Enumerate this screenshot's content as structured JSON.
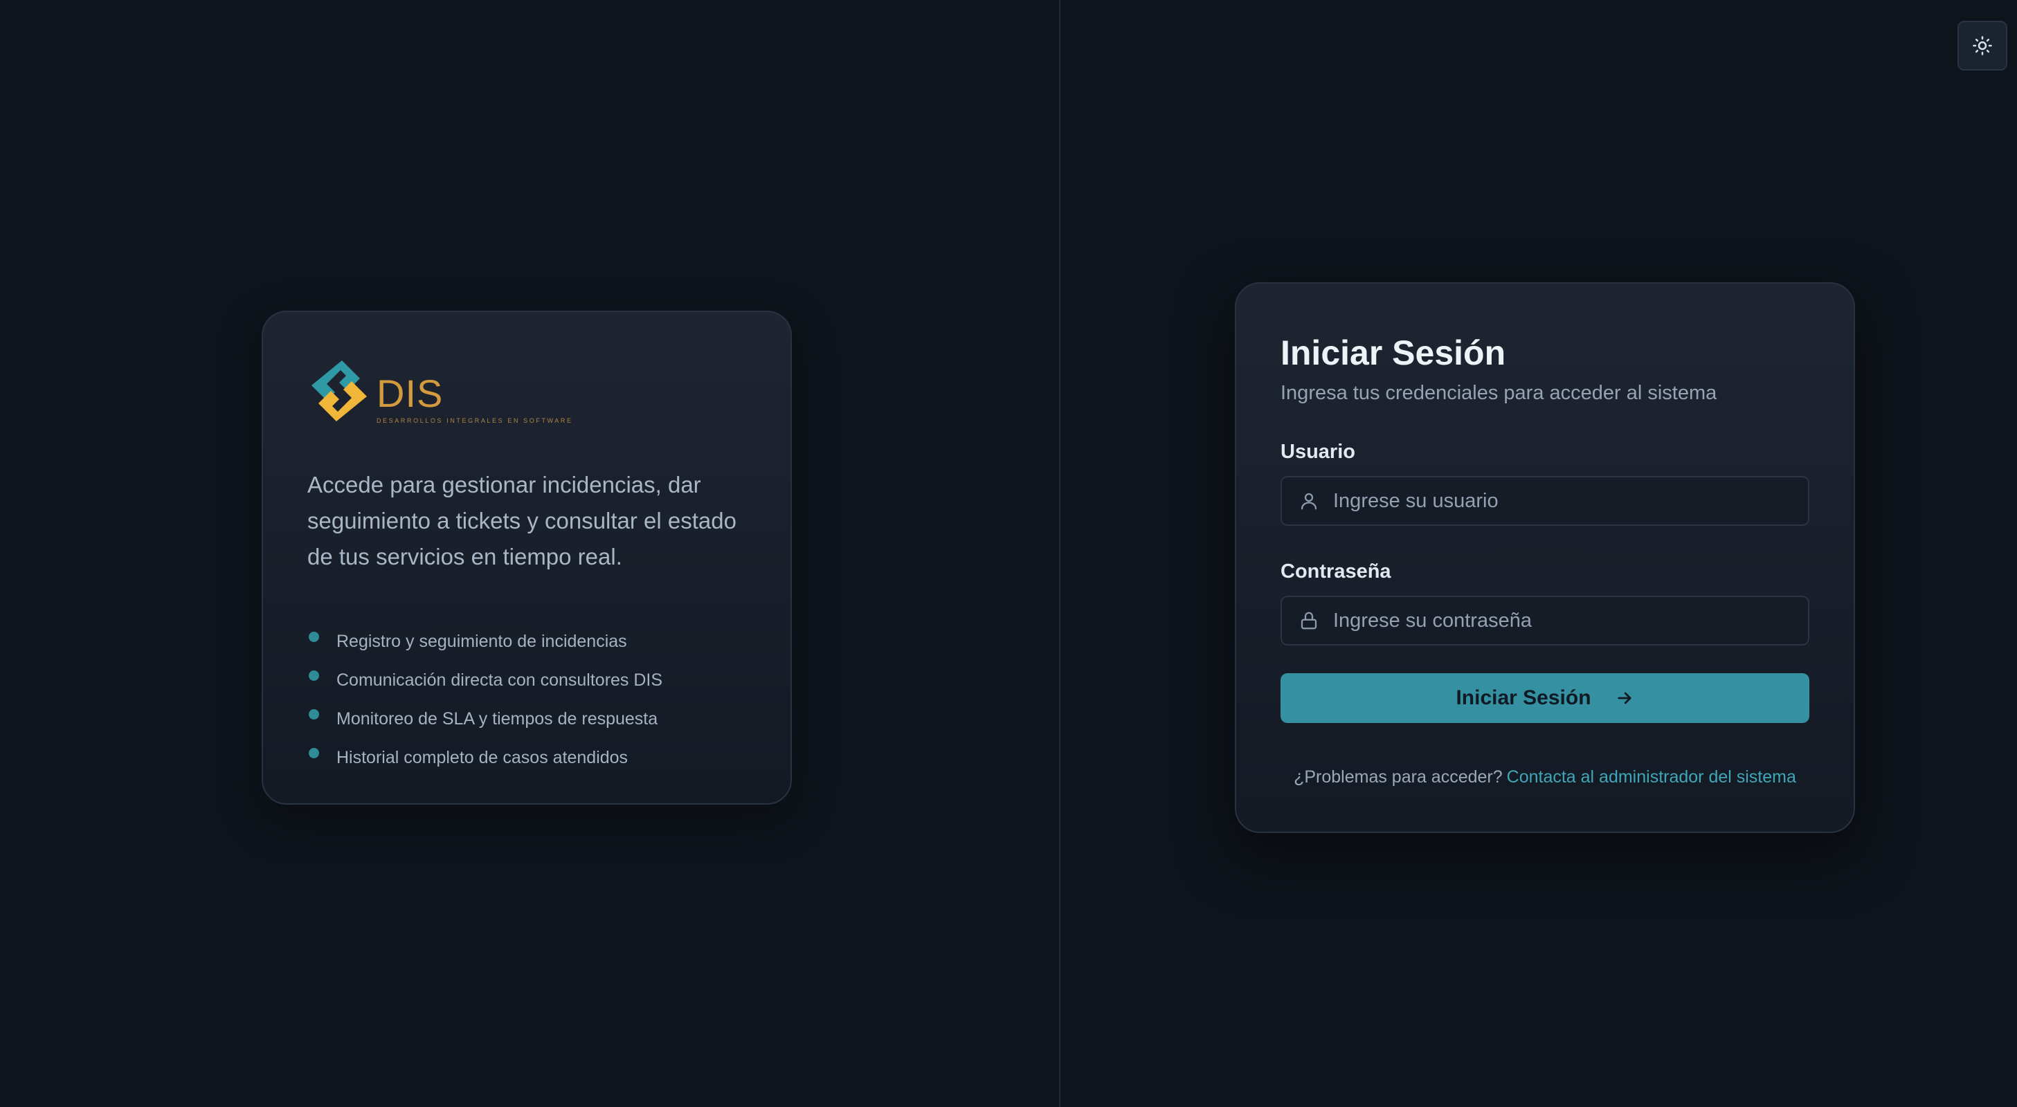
{
  "theme_toggle": {
    "icon": "sun-icon"
  },
  "info_card": {
    "logo": {
      "name": "DIS",
      "tagline": "DESARROLLOS INTEGRALES EN SOFTWARE",
      "colors": {
        "teal": "#2f9aa6",
        "gold": "#f0b63a",
        "text": "#d49a3e"
      }
    },
    "intro": "Accede para gestionar incidencias, dar seguimiento a tickets y consultar el estado de tus servicios en tiempo real.",
    "features": [
      "Registro y seguimiento de incidencias",
      "Comunicación directa con consultores DIS",
      "Monitoreo de SLA y tiempos de respuesta",
      "Historial completo de casos atendidos"
    ]
  },
  "login": {
    "title": "Iniciar Sesión",
    "subtitle": "Ingresa tus credenciales para acceder al sistema",
    "username": {
      "label": "Usuario",
      "placeholder": "Ingrese su usuario",
      "value": "",
      "icon": "user-icon"
    },
    "password": {
      "label": "Contraseña",
      "placeholder": "Ingrese su contraseña",
      "value": "",
      "icon": "lock-icon"
    },
    "submit_label": "Iniciar Sesión",
    "help_text": "¿Problemas para acceder?",
    "help_link": "Contacta al administrador del sistema"
  },
  "colors": {
    "background": "#0f141c",
    "accent": "#3590a1",
    "link": "#3fa6b8"
  }
}
